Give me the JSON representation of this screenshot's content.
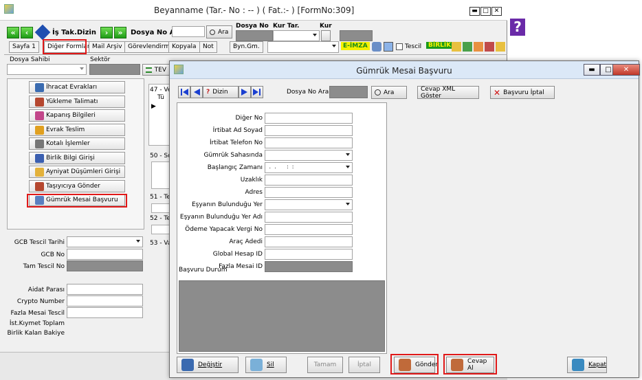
{
  "main_window": {
    "title": "Beyanname (Tar.- No : -- ) ( Fat.:- )  [FormNo:309]",
    "toolbar": {
      "is_takip_label": "İş Tak.Dizin",
      "dosya_no_ara_label": "Dosya No Ara",
      "ara_button": "Ara",
      "dosya_no_label": "Dosya No",
      "kur_tar_label": "Kur Tar.",
      "kur_label": "Kur"
    },
    "tabs": [
      "Sayfa 1",
      "Diğer Formlar",
      "Mail Arşiv",
      "Görevlendirme",
      "Kopyala",
      "Not",
      "Byn.Gm."
    ],
    "tab_extras": {
      "eimza": "E-İMZA",
      "tescil": "Tescil",
      "birlik": "BİRLİK"
    },
    "dosya_sahibi_label": "Dosya Sahibi",
    "sektor_label": "Sektör",
    "tev_label": "TEV",
    "side_menu": [
      {
        "label": "İhracat Evrakları",
        "icon": "export-docs-icon",
        "color": "#3a6bb0"
      },
      {
        "label": "Yükleme Talimatı",
        "icon": "loading-icon",
        "color": "#b5472f"
      },
      {
        "label": "Kapanış Bilgileri",
        "icon": "closing-icon",
        "color": "#c2468a"
      },
      {
        "label": "Evrak Teslim",
        "icon": "delivery-icon",
        "color": "#e0a020"
      },
      {
        "label": "Kotalı İşlemler",
        "icon": "quota-icon",
        "color": "#777777"
      },
      {
        "label": "Birlik Bilgi Girişi",
        "icon": "union-icon",
        "color": "#3b5fb0"
      },
      {
        "label": "Ayniyat Düşümleri Girişi",
        "icon": "deduction-icon",
        "color": "#e3b13a"
      },
      {
        "label": "Taşıyıcıya Gönder",
        "icon": "carrier-icon",
        "color": "#b5472f"
      },
      {
        "label": "Gümrük Mesai Başvuru",
        "icon": "customs-overtime-icon",
        "color": "#5a7fc0"
      }
    ],
    "col_labels": {
      "c47": "47 - Ve",
      "c47b": "Tü",
      "c50": "50 - Sc",
      "c51": "51 - Te",
      "c52": "52 - Te",
      "c53": "53 - Va"
    },
    "left_fields": {
      "gcb_tescil_tarihi": "GCB Tescil Tarihi",
      "gcb_no": "GCB No",
      "tam_tescil_no": "Tam Tescil No",
      "aidat_parasi": "Aidat Parası",
      "crypto_number": "Crypto Number",
      "fazla_mesai_tescil": "Fazla Mesai Tescil",
      "ist_kiymet_toplam": "İst.Kıymet Toplam",
      "birlik_kalan_bakiye": "Birlik Kalan Bakiye"
    }
  },
  "modal": {
    "title": "Gümrük Mesai Başvuru",
    "toolbar": {
      "dizin_label": "Dizin",
      "dosya_no_ara_label": "Dosya No Ara",
      "ara_button": "Ara",
      "cevap_xml_button": "Cevap XML Göster",
      "basvuru_iptal_button": "Başvuru İptal"
    },
    "fields": [
      {
        "label": "Diğer No",
        "type": "text",
        "value": ""
      },
      {
        "label": "İrtibat Ad Soyad",
        "type": "text",
        "value": ""
      },
      {
        "label": "İrtibat Telefon No",
        "type": "text",
        "value": ""
      },
      {
        "label": "Gümrük Sahasında",
        "type": "select",
        "value": ""
      },
      {
        "label": "Başlangıç Zamanı",
        "type": "select",
        "value": " .  .      :  :"
      },
      {
        "label": "Uzaklık",
        "type": "text",
        "value": ""
      },
      {
        "label": "Adres",
        "type": "text",
        "value": ""
      },
      {
        "label": "Eşyanın Bulunduğu Yer",
        "type": "select",
        "value": ""
      },
      {
        "label": "Eşyanın Bulunduğu Yer Adı",
        "type": "text",
        "value": ""
      },
      {
        "label": "Ödeme Yapacak Vergi No",
        "type": "text",
        "value": ""
      },
      {
        "label": "Araç Adedi",
        "type": "text",
        "value": ""
      },
      {
        "label": "Global Hesap ID",
        "type": "text",
        "value": ""
      },
      {
        "label": "Fazla Mesai ID",
        "type": "readonly",
        "value": ""
      }
    ],
    "basvuru_durum_label": "Başvuru Durum",
    "buttons": {
      "degistir": "Değiştir",
      "sil": "Sil",
      "tamam": "Tamam",
      "iptal": "İptal",
      "gonder": "Gönder",
      "cevap_al": "Cevap Al",
      "kapat": "Kapat"
    }
  },
  "colors": {
    "highlight_red": "#e01818",
    "nav_blue": "#1a3fd0",
    "green_btn": "#1e9c17",
    "gray_field": "#8c8c8c"
  }
}
